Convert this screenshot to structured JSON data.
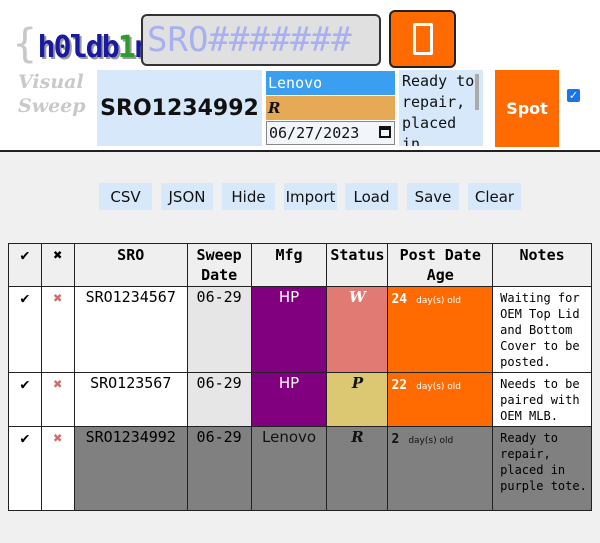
{
  "app": {
    "logo_brace_open": "{",
    "logo_word_a": "h0ldb",
    "logo_word_b": "1",
    "logo_word_c": "nz",
    "logo_brace_close": "}",
    "subtitle_line1": "Visual",
    "subtitle_line2": "Sweep"
  },
  "search": {
    "placeholder": "SRO#######",
    "value": ""
  },
  "entry": {
    "sro": "SRO1234992",
    "mfg": "Lenovo",
    "status": "R",
    "date": "06/27/2023",
    "notes": "Ready to repair, placed in",
    "spot_label": "Spot",
    "checkbox_checked": true
  },
  "toolbar": {
    "buttons": [
      "CSV",
      "JSON",
      "Hide",
      "Import",
      "Load",
      "Save",
      "Clear"
    ]
  },
  "table": {
    "headers": {
      "check": "✔",
      "delete": "✖",
      "sro": "SRO",
      "sweep_date_1": "Sweep",
      "sweep_date_2": "Date",
      "mfg": "Mfg",
      "status": "Status",
      "age_1": "Post Date",
      "age_2": "Age",
      "notes": "Notes"
    },
    "rows": [
      {
        "check": "✔",
        "delete": "✖",
        "sro": "SRO1234567",
        "sweep_date": "06-29",
        "mfg": "HP",
        "status": "W",
        "age_days": "24",
        "age_unit": "day(s) old",
        "notes": "Waiting for OEM Top Lid and Bottom Cover to be posted.",
        "colors": {
          "mfg": "#800080",
          "mfg_text": "#ffffff",
          "status": "#e07a72",
          "status_text": "#ffffff",
          "age": "#ff6b00",
          "age_text": "#ffffff"
        }
      },
      {
        "check": "✔",
        "delete": "✖",
        "sro": "SRO123567",
        "sweep_date": "06-29",
        "mfg": "HP",
        "status": "P",
        "age_days": "22",
        "age_unit": "day(s) old",
        "notes": "Needs to be paired with OEM MLB.",
        "colors": {
          "mfg": "#800080",
          "mfg_text": "#ffffff",
          "status": "#dcc873",
          "status_text": "#111111",
          "age": "#ff6b00",
          "age_text": "#ffffff"
        }
      },
      {
        "check": "✔",
        "delete": "✖",
        "sro": "SRO1234992",
        "sweep_date": "06-29",
        "mfg": "Lenovo",
        "status": "R",
        "age_days": "2",
        "age_unit": "day(s) old",
        "notes": "Ready to repair, placed in purple tote.",
        "colors": {
          "mfg": "#808080",
          "mfg_text": "#111111",
          "status": "#808080",
          "status_text": "#111111",
          "age": "#808080",
          "age_text": "#111111"
        }
      }
    ]
  },
  "colors": {
    "accent": "#ff6b00",
    "field_bg": "#d6e8fa",
    "mfg_select": "#3a9ff0",
    "status_select": "#e6aa56"
  }
}
